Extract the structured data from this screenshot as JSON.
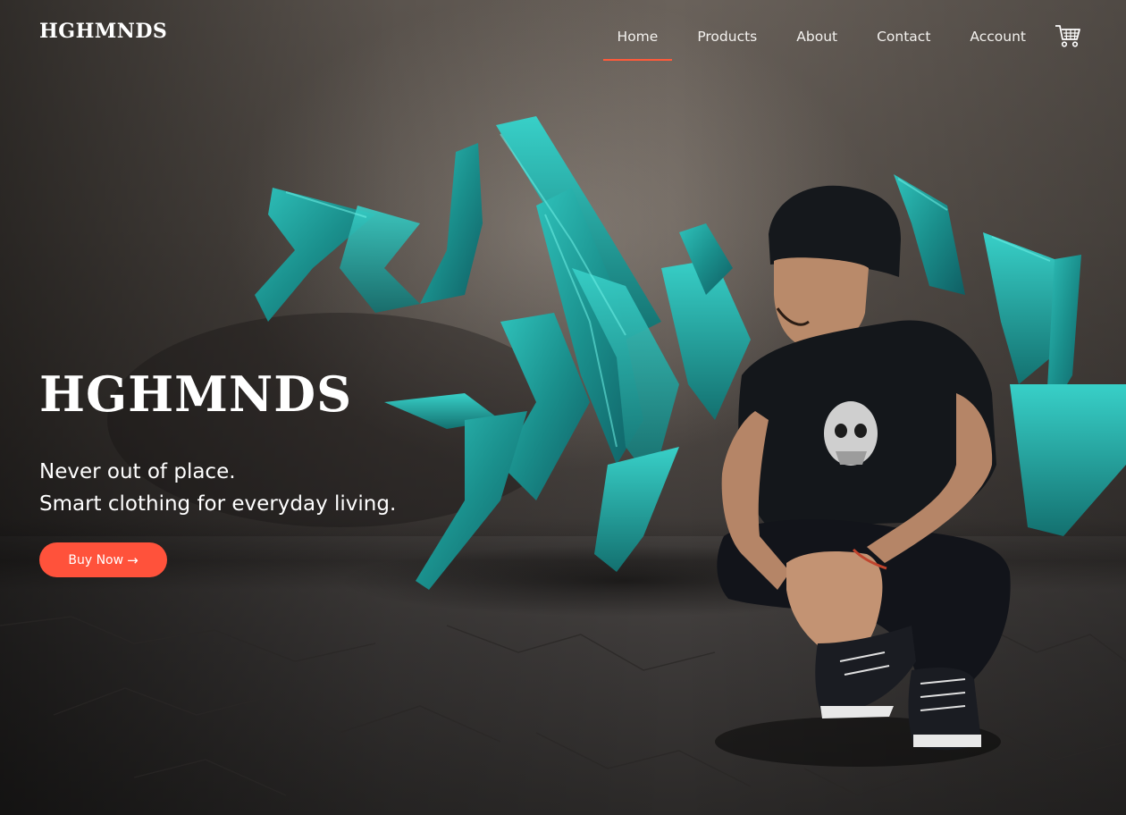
{
  "brand": "HGHMNDS",
  "nav": {
    "items": [
      {
        "label": "Home",
        "active": true
      },
      {
        "label": "Products",
        "active": false
      },
      {
        "label": "About",
        "active": false
      },
      {
        "label": "Contact",
        "active": false
      },
      {
        "label": "Account",
        "active": false
      }
    ],
    "cart_icon": "cart-icon"
  },
  "hero": {
    "title": "HGHMNDS",
    "subtitle_line1": "Never out of place.",
    "subtitle_line2": "Smart clothing for everyday living.",
    "cta_label": "Buy Now",
    "cta_arrow": "→"
  },
  "colors": {
    "accent": "#ff523b",
    "graffiti": "#1fa7a3",
    "text": "#ffffff"
  }
}
